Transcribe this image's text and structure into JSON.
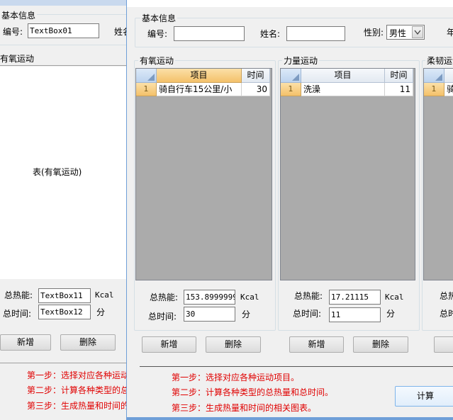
{
  "back_window": {
    "basic_info_label": "基本信息",
    "id_label": "编号:",
    "id_value": "TextBox01",
    "name_label": "姓名",
    "aerobic_label": "有氧运动",
    "table_placeholder": "表(有氧运动)",
    "total_cal_label": "总热能:",
    "total_cal_value": "TextBox11",
    "kcal_unit": "Kcal",
    "total_time_label": "总时间:",
    "total_time_value": "TextBox12",
    "minute_unit": "分",
    "add_button": "新增",
    "delete_button": "删除",
    "steps": [
      "第一步：选择对应各种运动",
      "第二步：计算各种类型的总",
      "第三步：生成热量和时间的"
    ]
  },
  "front_window": {
    "basic_info_label": "基本信息",
    "id_label": "编号:",
    "id_value": "",
    "name_label": "姓名:",
    "name_value": "",
    "gender_label": "性别:",
    "gender_value": "男性",
    "age_label": "年",
    "panels": [
      {
        "title": "有氧运动",
        "col_item": "项目",
        "col_time": "时间",
        "rows": [
          {
            "num": "1",
            "item": "骑自行车15公里/小",
            "time": "30"
          }
        ],
        "total_cal_label": "总热能:",
        "total_cal_value": "153.89999999",
        "kcal_unit": "Kcal",
        "total_time_label": "总时间:",
        "total_time_value": "30",
        "minute_unit": "分",
        "add_button": "新增",
        "delete_button": "删除"
      },
      {
        "title": "力量运动",
        "col_item": "项目",
        "col_time": "时间",
        "rows": [
          {
            "num": "1",
            "item": "洗澡",
            "time": "11"
          }
        ],
        "total_cal_label": "总热能:",
        "total_cal_value": "17.21115",
        "kcal_unit": "Kcal",
        "total_time_label": "总时间:",
        "total_time_value": "11",
        "minute_unit": "分",
        "add_button": "新增",
        "delete_button": "删除"
      },
      {
        "title": "柔韧运动",
        "rows": [
          {
            "num": "1",
            "item": "骑"
          }
        ],
        "total_cal_label": "总热",
        "total_time_label": "总时"
      }
    ],
    "steps": [
      "第一步：选择对应各种运动项目。",
      "第二步：计算各种类型的总热量和总时间。",
      "第三步：生成热量和时间的相关图表。"
    ],
    "calc_button": "计算"
  }
}
